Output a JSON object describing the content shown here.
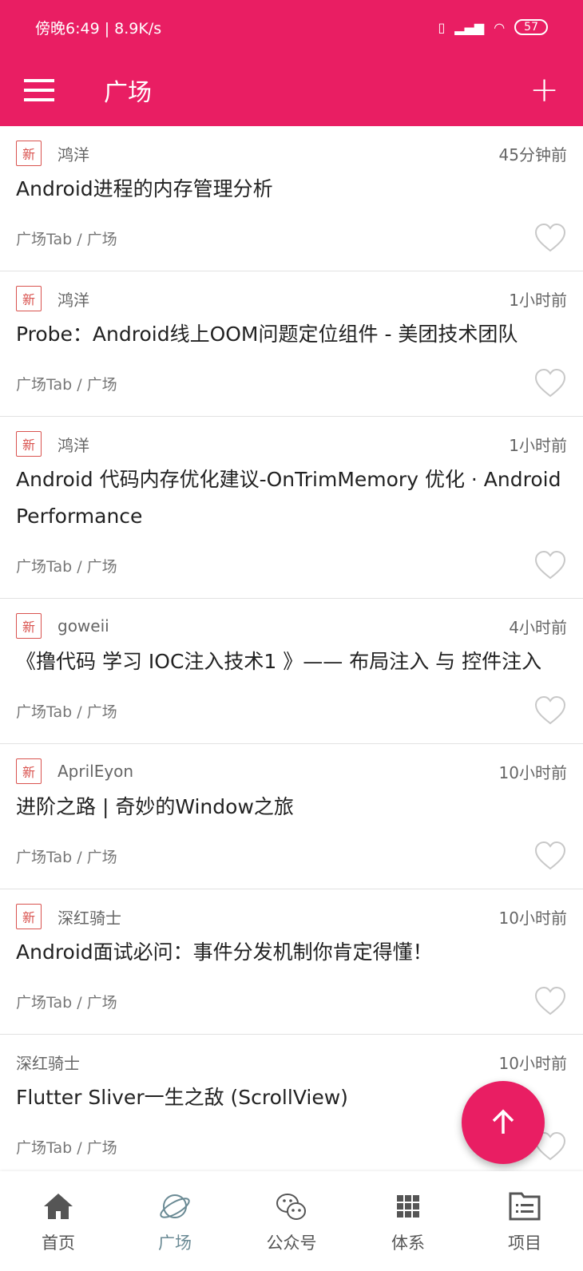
{
  "status": {
    "time": "傍晚6:49 | 8.9K/s",
    "battery": "57"
  },
  "appbar": {
    "title": "广场",
    "menu_icon": "menu-icon",
    "add_icon": "plus-icon"
  },
  "colors": {
    "primary": "#e91e63",
    "tag": "#d9534f"
  },
  "items": [
    {
      "tag": "新",
      "author": "鸿洋",
      "time": "45分钟前",
      "title": "Android进程的内存管理分析",
      "category": "广场Tab / 广场"
    },
    {
      "tag": "新",
      "author": "鸿洋",
      "time": "1小时前",
      "title": "Probe：Android线上OOM问题定位组件 - 美团技术团队",
      "category": "广场Tab / 广场"
    },
    {
      "tag": "新",
      "author": "鸿洋",
      "time": "1小时前",
      "title": "Android 代码内存优化建议-OnTrimMemory 优化 · Android Performance",
      "category": "广场Tab / 广场"
    },
    {
      "tag": "新",
      "author": "goweii",
      "time": "4小时前",
      "title": "《撸代码 学习 IOC注入技术1 》—— 布局注入 与 控件注入",
      "category": "广场Tab / 广场"
    },
    {
      "tag": "新",
      "author": "AprilEyon",
      "time": "10小时前",
      "title": "进阶之路 | 奇妙的Window之旅",
      "category": "广场Tab / 广场"
    },
    {
      "tag": "新",
      "author": "深红骑士",
      "time": "10小时前",
      "title": "Android面试必问：事件分发机制你肯定得懂！",
      "category": "广场Tab / 广场"
    },
    {
      "tag": "",
      "author": "深红骑士",
      "time": "10小时前",
      "title": "Flutter Sliver一生之敌 (ScrollView)",
      "category": "广场Tab / 广场"
    }
  ],
  "nav": [
    {
      "label": "首页",
      "icon": "home-icon"
    },
    {
      "label": "广场",
      "icon": "planet-icon",
      "active": true
    },
    {
      "label": "公众号",
      "icon": "wechat-icon"
    },
    {
      "label": "体系",
      "icon": "grid-icon"
    },
    {
      "label": "项目",
      "icon": "folder-list-icon"
    }
  ]
}
